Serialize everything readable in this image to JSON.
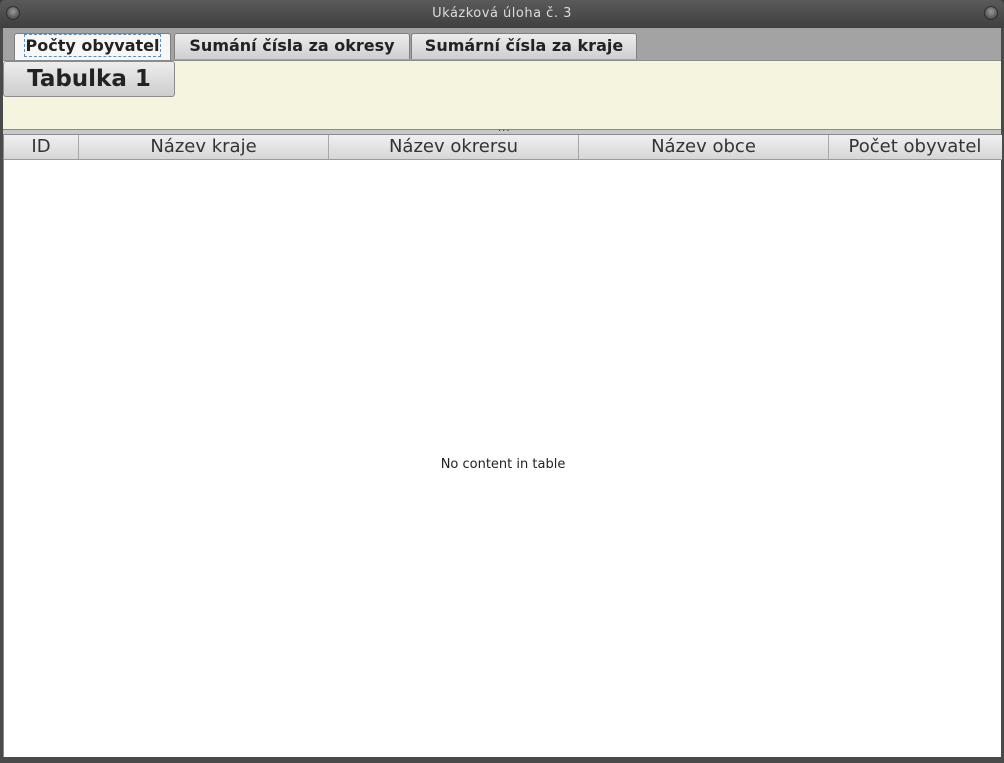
{
  "window": {
    "title": "Ukázková úloha č. 3"
  },
  "tabs": [
    {
      "label": "Počty obyvatel",
      "active": true
    },
    {
      "label": "Sumání čísla za okresy",
      "active": false
    },
    {
      "label": "Sumární čísla za kraje",
      "active": false
    }
  ],
  "toolbar": {
    "table_button_label": "Tabulka 1",
    "divider_grip": "..."
  },
  "table": {
    "columns": [
      "ID",
      "Název kraje",
      "Název okrersu",
      "Název obce",
      "Počet obyvatel"
    ],
    "placeholder": "No content in table"
  }
}
